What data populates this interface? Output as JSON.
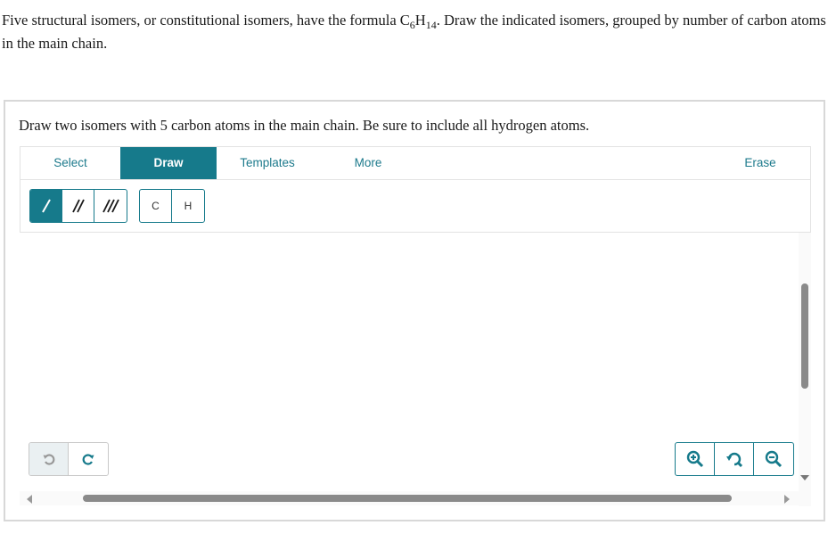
{
  "intro": {
    "text_before": "Five structural isomers, or constitutional isomers, have the formula C",
    "sub1": "6",
    "h": "H",
    "sub2": "14",
    "text_after": ". Draw the indicated isomers, grouped by number of carbon atoms in the main chain."
  },
  "question": "Draw two isomers with 5 carbon atoms in the main chain. Be sure to include all hydrogen atoms.",
  "tabs": {
    "select": "Select",
    "draw": "Draw",
    "templates": "Templates",
    "more": "More",
    "erase": "Erase"
  },
  "tools": {
    "bonds": [
      "single-bond-icon",
      "double-bond-icon",
      "triple-bond-icon"
    ],
    "atoms": [
      "C",
      "H"
    ]
  },
  "colors": {
    "accent": "#167a8b",
    "accent_text": "#1d7a8c"
  },
  "icons": {
    "undo": "undo-icon",
    "redo": "redo-icon",
    "zoom_in": "zoom-in-icon",
    "zoom_reset": "zoom-reset-icon",
    "zoom_out": "zoom-out-icon"
  }
}
